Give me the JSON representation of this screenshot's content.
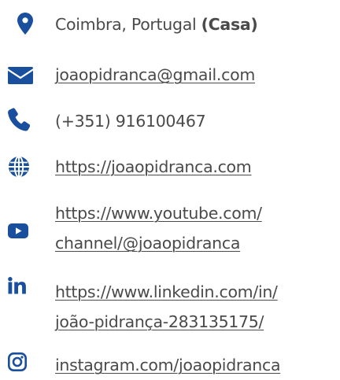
{
  "contact": {
    "location": {
      "city": "Coimbra, Portugal",
      "tag": "(Casa)",
      "icon": "map-marker-icon"
    },
    "email": {
      "text": "joaopidranca@gmail.com",
      "icon": "envelope-icon"
    },
    "phone": {
      "text": "(+351) 916100467",
      "icon": "phone-icon"
    },
    "website": {
      "text": "https://joaopidranca.com",
      "icon": "globe-icon"
    },
    "youtube": {
      "line1": "https://www.youtube.com/",
      "line2": "channel/@joaopidranca",
      "icon": "youtube-icon"
    },
    "linkedin": {
      "line1": "https://www.linkedin.com/in/",
      "line2": "joão-pidrança-283135175/",
      "icon": "linkedin-icon"
    },
    "instagram": {
      "text": "instagram.com/joaopidranca",
      "icon": "instagram-icon"
    }
  },
  "colors": {
    "icon": "#1a4f9e",
    "text": "#4a4a4a"
  }
}
